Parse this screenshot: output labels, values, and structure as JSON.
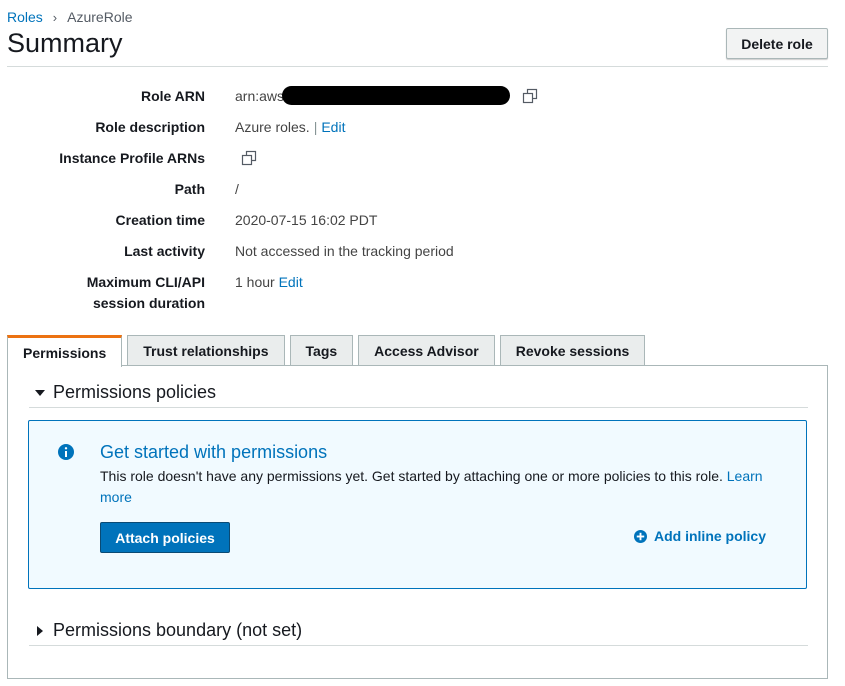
{
  "breadcrumb": {
    "parent": "Roles",
    "separator": "›",
    "current": "AzureRole"
  },
  "header": {
    "title": "Summary",
    "delete_label": "Delete role"
  },
  "details": {
    "role_arn": {
      "label": "Role ARN",
      "value": "arn:aws"
    },
    "role_description": {
      "label": "Role description",
      "value": "Azure roles.",
      "edit": "Edit"
    },
    "instance_profile": {
      "label": "Instance Profile ARNs"
    },
    "path": {
      "label": "Path",
      "value": "/"
    },
    "creation_time": {
      "label": "Creation time",
      "value": "2020-07-15 16:02 PDT"
    },
    "last_activity": {
      "label": "Last activity",
      "value": "Not accessed in the tracking period"
    },
    "max_session": {
      "label_line1": "Maximum CLI/API",
      "label_line2": "session duration",
      "value": "1 hour",
      "edit": "Edit"
    }
  },
  "tabs": [
    {
      "label": "Permissions",
      "active": true
    },
    {
      "label": "Trust relationships",
      "active": false
    },
    {
      "label": "Tags",
      "active": false
    },
    {
      "label": "Access Advisor",
      "active": false
    },
    {
      "label": "Revoke sessions",
      "active": false
    }
  ],
  "permissions": {
    "policies_title": "Permissions policies",
    "info": {
      "title": "Get started with permissions",
      "text": "This role doesn't have any permissions yet. Get started by attaching one or more policies to this role.",
      "learn_more": "Learn more",
      "attach_label": "Attach policies",
      "inline_label": "Add inline policy"
    },
    "boundary_title": "Permissions boundary (not set)"
  },
  "icons": {
    "copy": "copy-icon",
    "info": "info-icon",
    "add": "plus-circle-icon",
    "expanded": "caret-down-icon",
    "collapsed": "caret-right-icon",
    "breadcrumb_sep": "chevron-right-icon"
  },
  "colors": {
    "link": "#0073bb",
    "tab_active": "#ec7211",
    "info_bg": "#f1faff"
  }
}
